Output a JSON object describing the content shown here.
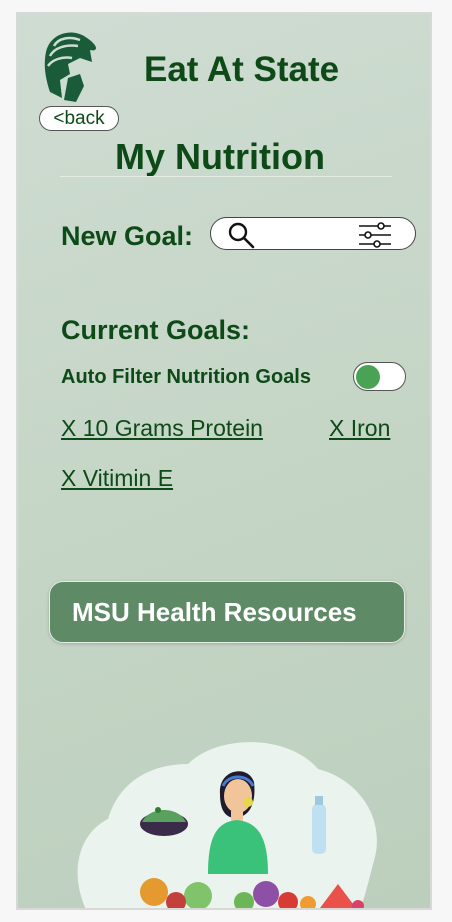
{
  "app": {
    "title": "Eat At State"
  },
  "nav": {
    "back_label": "<back"
  },
  "page": {
    "title": "My Nutrition"
  },
  "new_goal": {
    "label": "New Goal:",
    "search_value": ""
  },
  "current_goals": {
    "heading": "Current Goals:",
    "auto_filter_label": "Auto Filter Nutrition Goals",
    "auto_filter_on": true,
    "goals": [
      "X 10 Grams Protein",
      "X Iron",
      "X Vitimin E"
    ]
  },
  "resources": {
    "button_label": "MSU Health Resources"
  },
  "colors": {
    "brand_green": "#0e4a17",
    "button_green": "#5e8a66",
    "toggle_green": "#4aa355"
  },
  "icons": [
    "spartan-helmet-logo-icon",
    "search-icon",
    "filter-sliders-icon"
  ]
}
